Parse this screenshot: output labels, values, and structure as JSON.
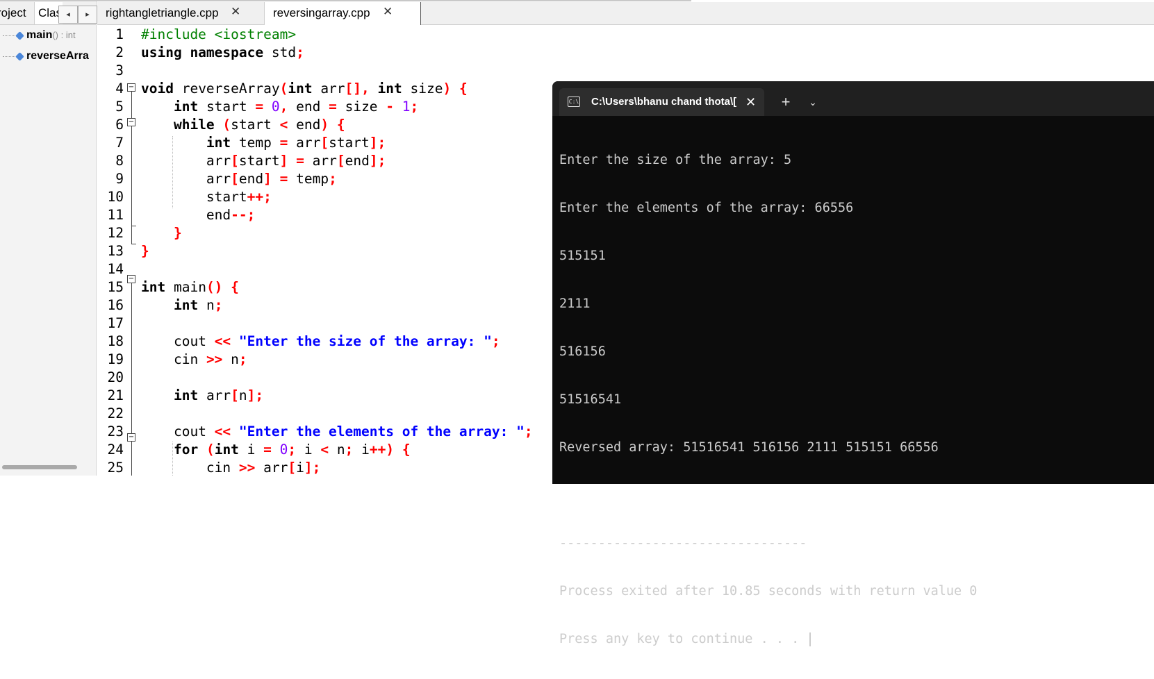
{
  "left_panel": {
    "tabs": [
      "roject",
      "Clas"
    ],
    "scroll_left": "◂",
    "scroll_right": "▸",
    "items": [
      {
        "name": "main",
        "signature": "() : int"
      },
      {
        "name": "reverseArra",
        "signature": ""
      }
    ]
  },
  "editor": {
    "tabs": [
      {
        "label": "rightangletriangle.cpp",
        "close": "✕"
      },
      {
        "label": "reversingarray.cpp",
        "close": "✕"
      }
    ],
    "line_numbers": [
      "1",
      "2",
      "3",
      "4",
      "5",
      "6",
      "7",
      "8",
      "9",
      "10",
      "11",
      "12",
      "13",
      "14",
      "15",
      "16",
      "17",
      "18",
      "19",
      "20",
      "21",
      "22",
      "23",
      "24",
      "25"
    ]
  },
  "terminal": {
    "tab_title": "C:\\Users\\bhanu chand thota\\[",
    "tab_close": "✕",
    "new_tab": "+",
    "dropdown": "⌄",
    "icon_text": "C:\\",
    "lines": [
      "Enter the size of the array: 5",
      "Enter the elements of the array: 66556",
      "515151",
      "2111",
      "516156",
      "51516541",
      "Reversed array: 51516541 516156 2111 515151 66556",
      "",
      "--------------------------------",
      "Process exited after 10.85 seconds with return value 0",
      "Press any key to continue . . . "
    ]
  },
  "code": {
    "l1": "#include <iostream>",
    "l2_kw": "using namespace",
    "l2_rest": " std",
    "l4_kw1": "void",
    "l4_a": " reverseArray",
    "l4_kw2": "int",
    "l4_b": " arr",
    "l4_kw3": "int",
    "l4_c": " size",
    "l5_kw": "int",
    "l5_a": " start ",
    "l5_n0": "0",
    "l5_b": " end ",
    "l5_c": " size ",
    "l5_n1": "1",
    "l6_kw": "while",
    "l6_a": "start ",
    "l6_b": " end",
    "l7_kw": "int",
    "l7_a": " temp ",
    "l7_b": " arr",
    "l7_c": "start",
    "l8_a": "arr",
    "l8_b": "start",
    "l8_c": "arr",
    "l8_d": "end",
    "l9_a": "arr",
    "l9_b": "end",
    "l9_c": " temp",
    "l10": "start",
    "l11": "end",
    "l15_kw": "int",
    "l15_a": " main",
    "l16_kw": "int",
    "l16_a": " n",
    "l18_a": "cout ",
    "l18_s": "\"Enter the size of the array: \"",
    "l19_a": "cin ",
    "l19_b": " n",
    "l21_kw": "int",
    "l21_a": " arr",
    "l21_b": "n",
    "l23_a": "cout ",
    "l23_s": "\"Enter the elements of the array: \"",
    "l24_kw1": "for",
    "l24_kw2": "int",
    "l24_a": " i ",
    "l24_n0": "0",
    "l24_b": " i ",
    "l24_c": " n",
    "l24_d": " i",
    "l25_a": "cin ",
    "l25_b": " arr",
    "l25_c": "i"
  }
}
